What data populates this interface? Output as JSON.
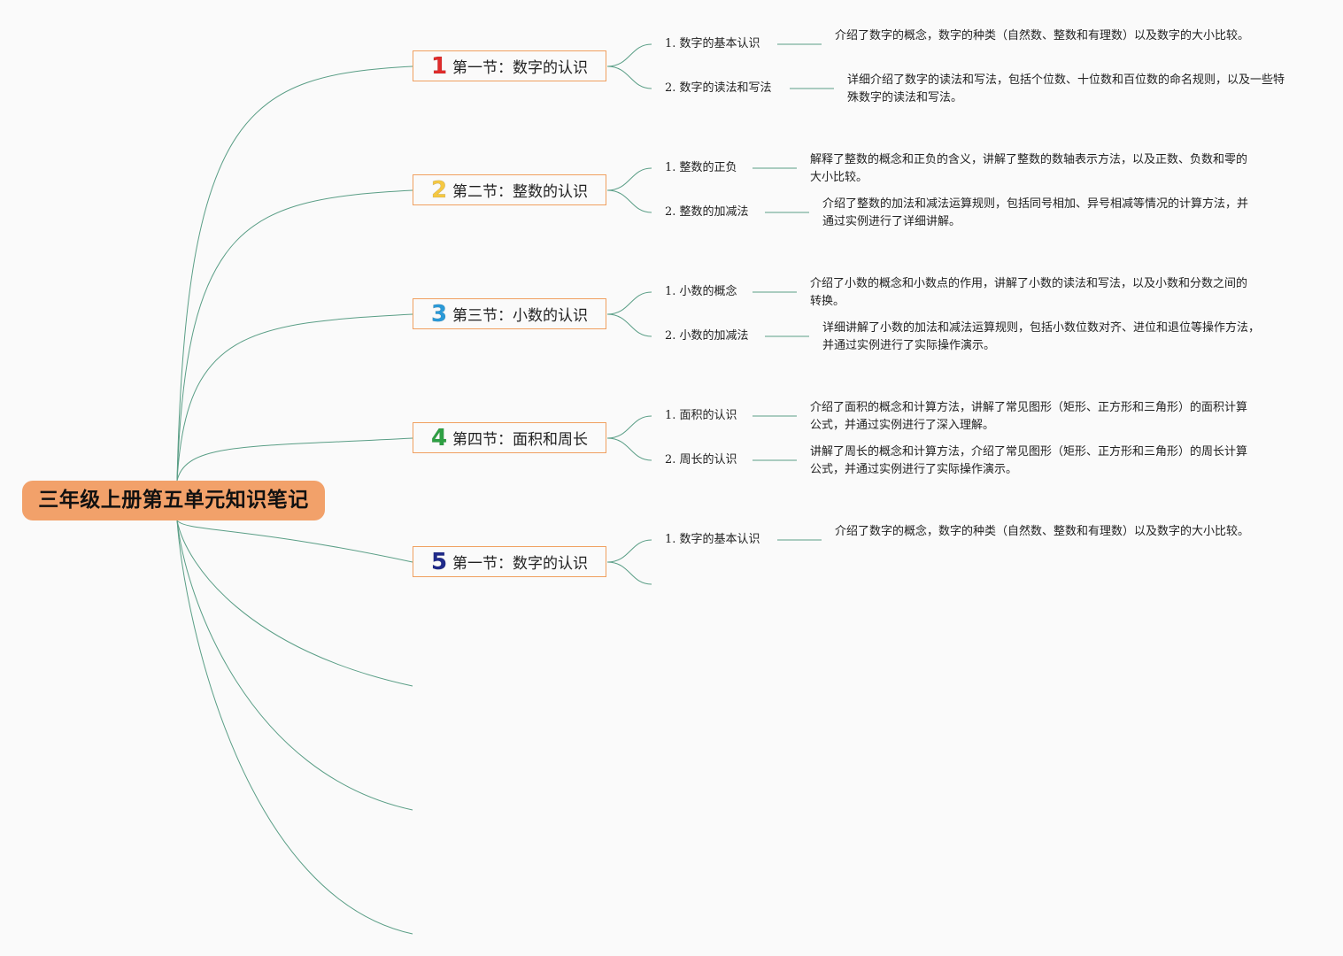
{
  "root": {
    "title": "三年级上册第五单元知识笔记"
  },
  "sections": [
    {
      "number": "1",
      "number_color": "#e02b2b",
      "title": "第一节：数字的认识",
      "items": [
        {
          "label": "1. 数字的基本认识",
          "description": "介绍了数字的概念，数字的种类（自然数、整数和有理数）以及数字的大小比较。"
        },
        {
          "label": "2. 数字的读法和写法",
          "description": "详细介绍了数字的读法和写法，包括个位数、十位数和百位数的命名规则，以及一些特殊数字的读法和写法。"
        }
      ]
    },
    {
      "number": "2",
      "number_color": "#f5c842",
      "title": "第二节：整数的认识",
      "items": [
        {
          "label": "1. 整数的正负",
          "description": "解释了整数的概念和正负的含义，讲解了整数的数轴表示方法，以及正数、负数和零的大小比较。"
        },
        {
          "label": "2. 整数的加减法",
          "description": "介绍了整数的加法和减法运算规则，包括同号相加、异号相减等情况的计算方法，并通过实例进行了详细讲解。"
        }
      ]
    },
    {
      "number": "3",
      "number_color": "#2a9ad8",
      "title": "第三节：小数的认识",
      "items": [
        {
          "label": "1. 小数的概念",
          "description": "介绍了小数的概念和小数点的作用，讲解了小数的读法和写法，以及小数和分数之间的转换。"
        },
        {
          "label": "2. 小数的加减法",
          "description": "详细讲解了小数的加法和减法运算规则，包括小数位数对齐、进位和退位等操作方法，并通过实例进行了实际操作演示。"
        }
      ]
    },
    {
      "number": "4",
      "number_color": "#2ea043",
      "title": "第四节：面积和周长",
      "items": [
        {
          "label": "1. 面积的认识",
          "description": "介绍了面积的概念和计算方法，讲解了常见图形（矩形、正方形和三角形）的面积计算公式，并通过实例进行了深入理解。"
        },
        {
          "label": "2. 周长的认识",
          "description": "讲解了周长的概念和计算方法，介绍了常见图形（矩形、正方形和三角形）的周长计算公式，并通过实例进行了实际操作演示。"
        }
      ]
    },
    {
      "number": "5",
      "number_color": "#1f2a8a",
      "title": "第一节：数字的认识",
      "items": [
        {
          "label": "1. 数字的基本认识",
          "description": "介绍了数字的概念，数字的种类（自然数、整数和有理数）以及数字的大小比较。"
        }
      ]
    }
  ],
  "style": {
    "link_color": "#5a9e86",
    "section_border": "#f0a060",
    "root_fill": "#f2a16a"
  }
}
